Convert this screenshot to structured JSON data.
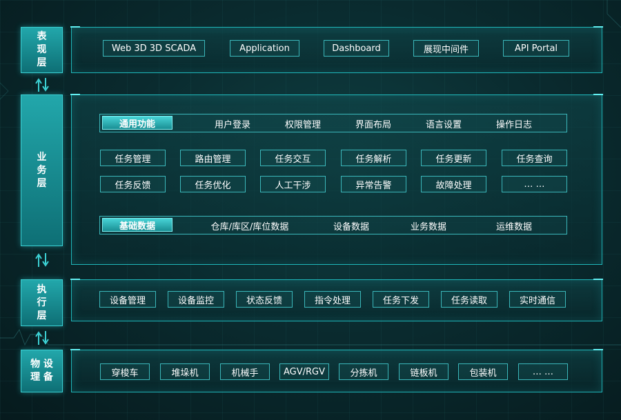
{
  "layers": {
    "presentation": {
      "label": "表\n现\n层",
      "items": [
        "Web 3D    3D SCADA",
        "Application",
        "Dashboard",
        "展现中间件",
        "API Portal"
      ]
    },
    "business": {
      "label": "业\n务\n层",
      "common": {
        "tag": "通用功能",
        "items": [
          "用户登录",
          "权限管理",
          "界面布局",
          "语言设置",
          "操作日志"
        ]
      },
      "tasks_row1": [
        "任务管理",
        "路由管理",
        "任务交互",
        "任务解析",
        "任务更新",
        "任务查询"
      ],
      "tasks_row2": [
        "任务反馈",
        "任务优化",
        "人工干涉",
        "异常告警",
        "故障处理",
        "… …"
      ],
      "base": {
        "tag": "基础数据",
        "items": [
          "仓库/库区/库位数据",
          "设备数据",
          "业务数据",
          "运维数据"
        ]
      }
    },
    "execution": {
      "label": "执\n行\n层",
      "items": [
        "设备管理",
        "设备监控",
        "状态反馈",
        "指令处理",
        "任务下发",
        "任务读取",
        "实时通信"
      ]
    },
    "physical": {
      "label": "物 设\n理 备",
      "items": [
        "穿梭车",
        "堆垛机",
        "机械手",
        "AGV/RGV",
        "分拣机",
        "链板机",
        "包装机",
        "… …"
      ]
    }
  },
  "colors": {
    "accent": "#1fb7ba",
    "label_fill": "#1a9196",
    "tag_fill": "#2fb4b8",
    "background": "#0a2b2f"
  }
}
